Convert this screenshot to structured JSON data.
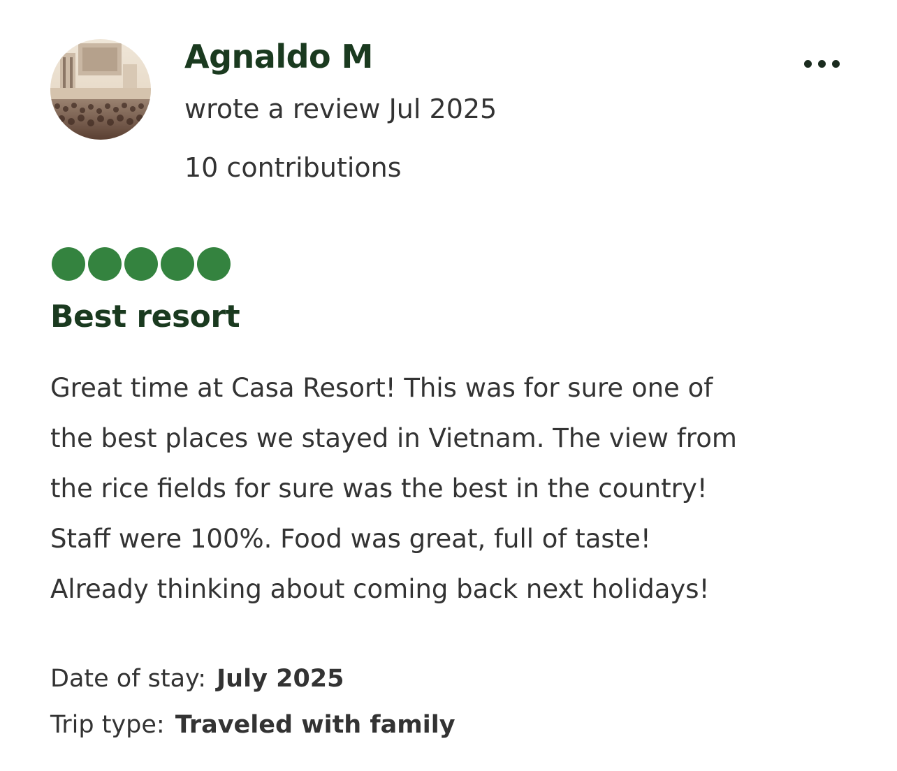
{
  "reviewer": {
    "name": "Agnaldo M",
    "review_meta": "wrote a review Jul 2025",
    "contributions": "10 contributions",
    "avatar_icon": "concert-crowd-photo"
  },
  "menu": {
    "icon": "more-options-icon"
  },
  "review": {
    "rating": {
      "value": 5,
      "max": 5
    },
    "title": "Best resort",
    "body_lines": [
      "Great time at Casa Resort! This was for sure one of",
      "the best places we stayed in Vietnam. The view from",
      "the rice fields for sure was the best in the country!",
      "Staff were 100%. Food was great, full of taste!",
      "Already thinking about coming back next holidays!"
    ]
  },
  "details": {
    "date_of_stay_label": "Date of stay:",
    "date_of_stay_value": "July 2025",
    "trip_type_label": "Trip type:",
    "trip_type_value": "Traveled with family"
  },
  "colors": {
    "bubble": "#34833f",
    "heading": "#1a3a1f",
    "text": "#333333"
  }
}
